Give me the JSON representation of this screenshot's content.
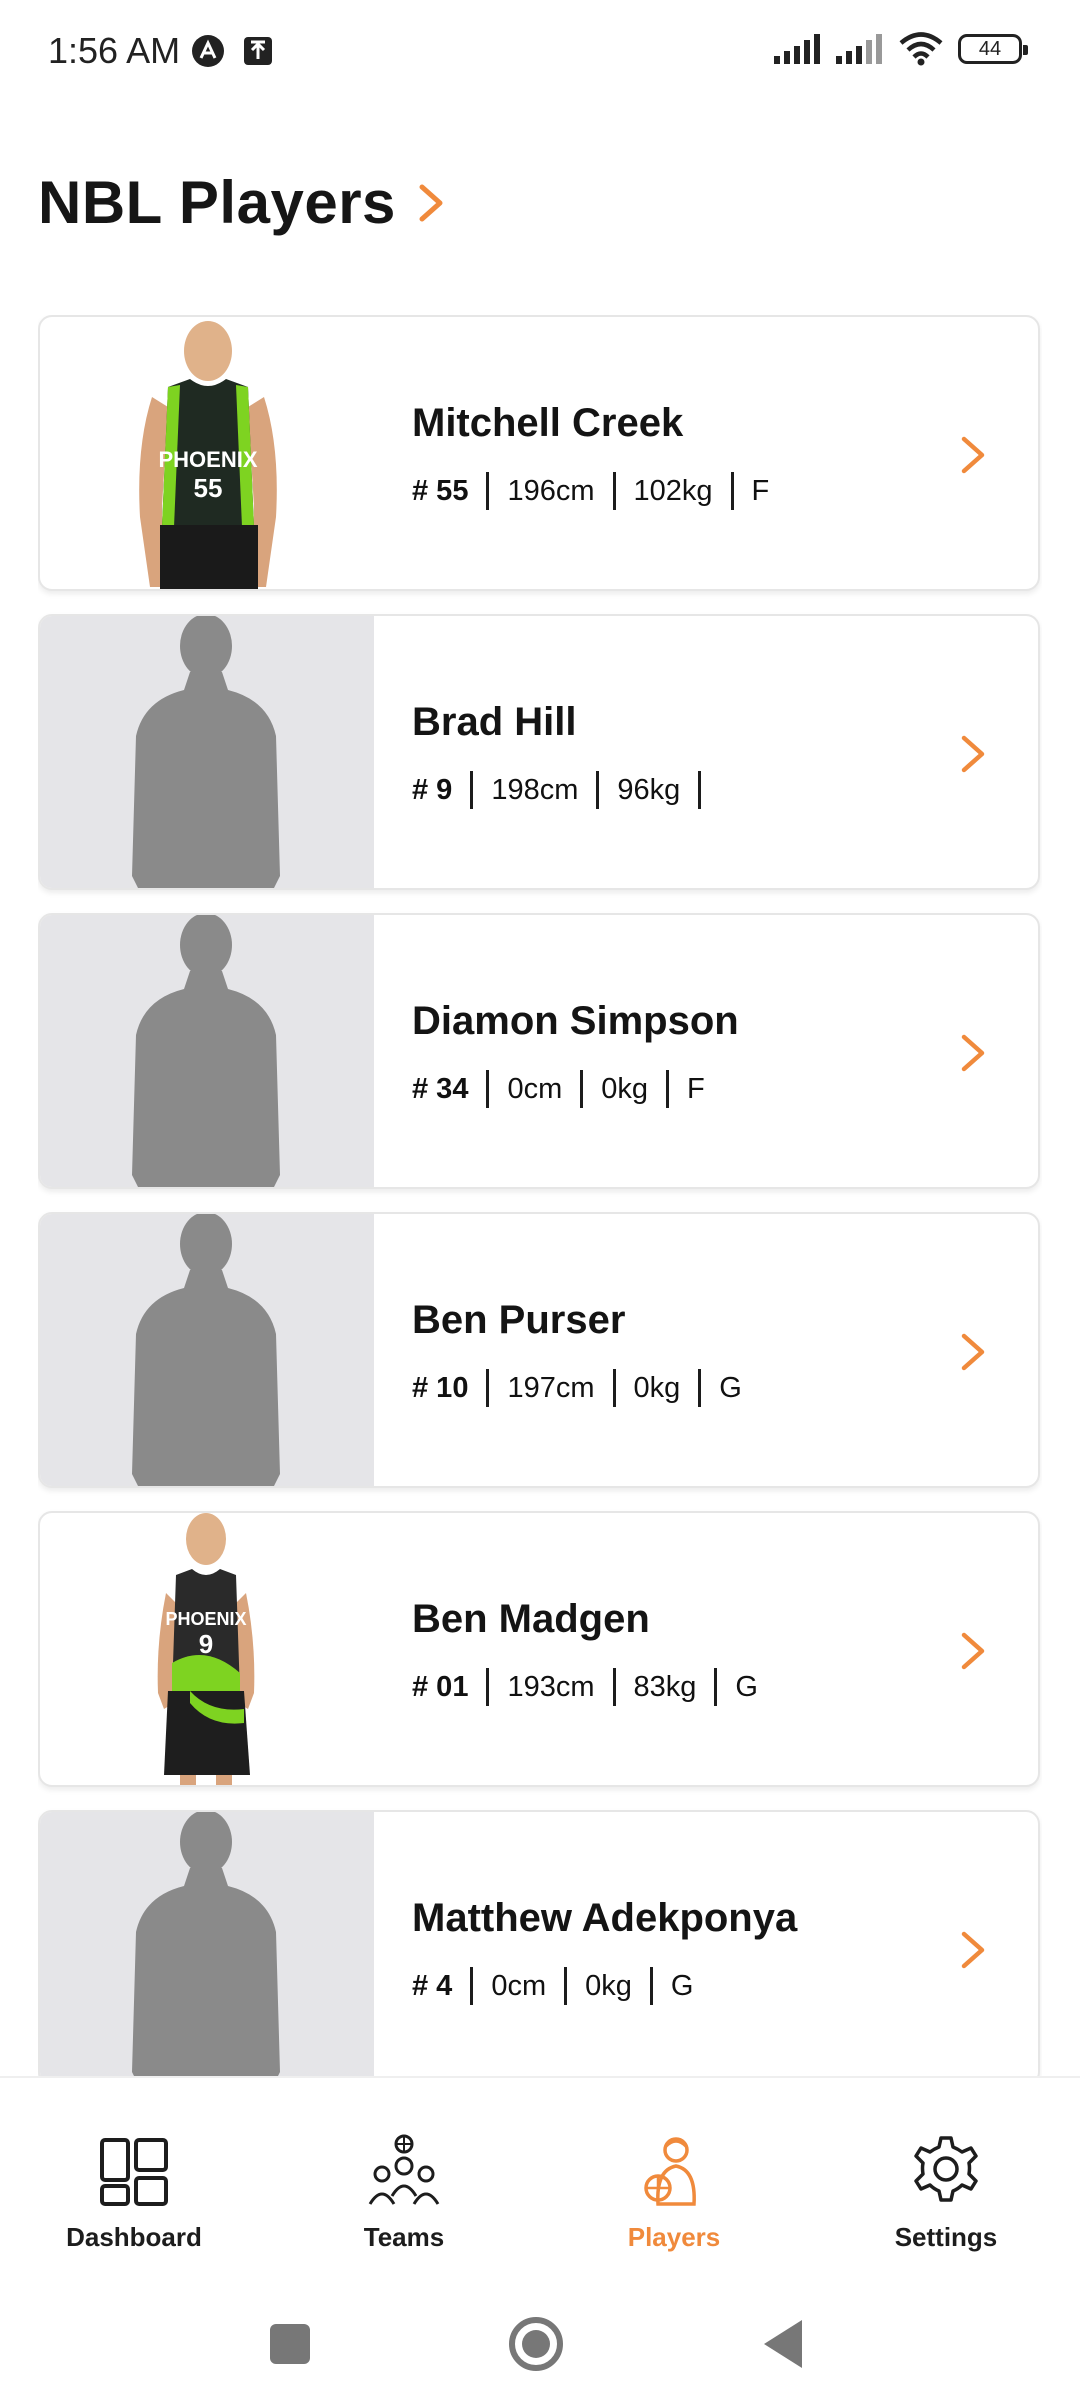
{
  "status_bar": {
    "time": "1:56 AM",
    "battery": "44",
    "icons": [
      "notification-a-icon",
      "upload-icon",
      "signal-icon",
      "signal-icon-2",
      "wifi-icon",
      "battery-icon"
    ]
  },
  "header": {
    "title": "NBL Players"
  },
  "colors": {
    "accent": "#f08a3c",
    "silhouette_bg": "#e5e5e8",
    "silhouette": "#8a8a8a"
  },
  "players": [
    {
      "name": "Mitchell Creek",
      "number": "# 55",
      "height": "196cm",
      "weight": "102kg",
      "position": "F",
      "photo": "photo",
      "jersey_text": "PHOENIX",
      "jersey_number": "55"
    },
    {
      "name": "Brad Hill",
      "number": "# 9",
      "height": "198cm",
      "weight": "96kg",
      "position": "",
      "photo": "silhouette"
    },
    {
      "name": "Diamon Simpson",
      "number": "# 34",
      "height": "0cm",
      "weight": "0kg",
      "position": "F",
      "photo": "silhouette"
    },
    {
      "name": "Ben Purser",
      "number": "# 10",
      "height": "197cm",
      "weight": "0kg",
      "position": "G",
      "photo": "silhouette"
    },
    {
      "name": "Ben Madgen",
      "number": "# 01",
      "height": "193cm",
      "weight": "83kg",
      "position": "G",
      "photo": "photo",
      "jersey_text": "PHOENIX",
      "jersey_number": "9"
    },
    {
      "name": "Matthew Adekponya",
      "number": "# 4",
      "height": "0cm",
      "weight": "0kg",
      "position": "G",
      "photo": "silhouette"
    }
  ],
  "bottom_nav": {
    "items": [
      {
        "label": "Dashboard",
        "icon": "dashboard-icon",
        "active": false
      },
      {
        "label": "Teams",
        "icon": "teams-icon",
        "active": false
      },
      {
        "label": "Players",
        "icon": "players-icon",
        "active": true
      },
      {
        "label": "Settings",
        "icon": "gear-icon",
        "active": false
      }
    ]
  },
  "system_nav": {
    "buttons": [
      "recents-button",
      "home-button",
      "back-button"
    ]
  }
}
